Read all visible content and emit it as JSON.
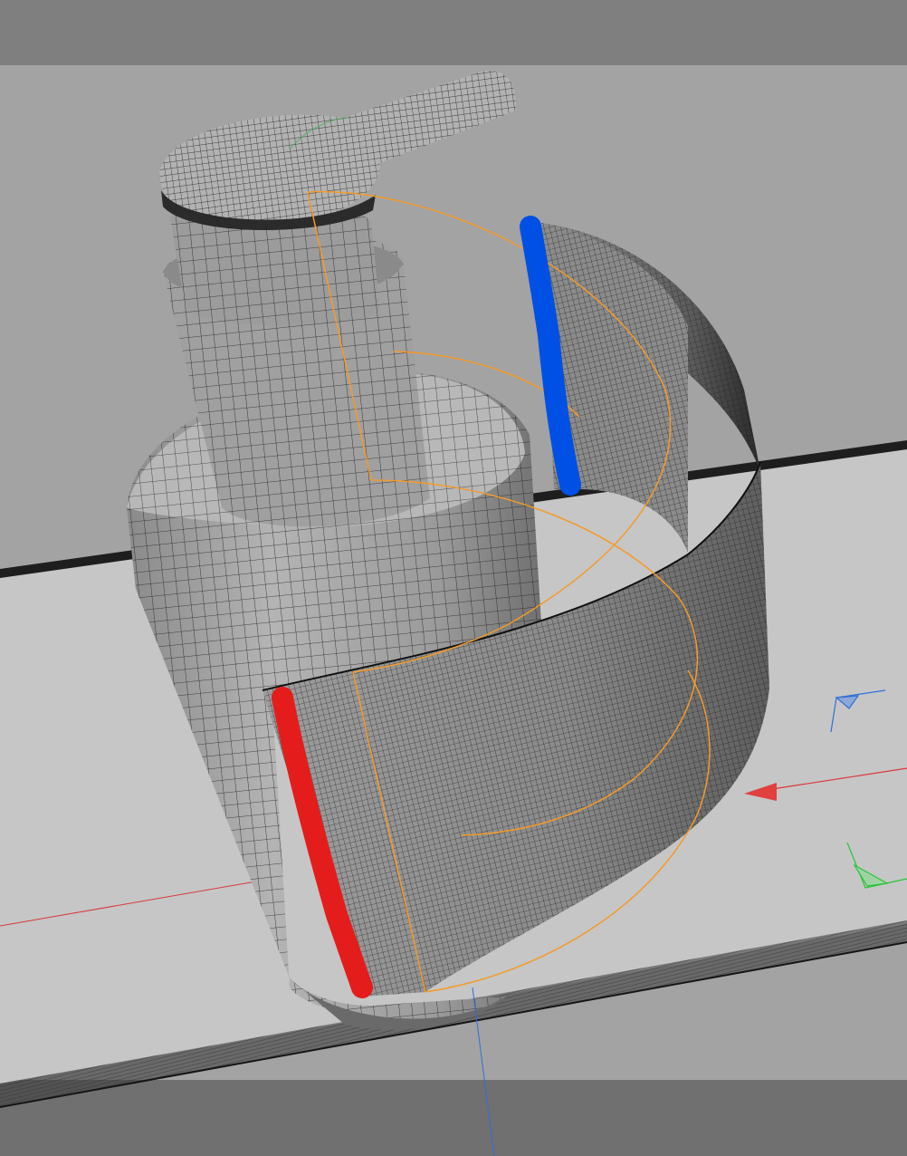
{
  "viewport": {
    "background_top": "#7f7f7f",
    "background_mid": "#a3a3a3",
    "background_floor": "#c9c9c9",
    "background_bottom": "#6f6f6f"
  },
  "scene": {
    "objects": [
      {
        "name": "bottle",
        "type": "wireframe-mesh"
      },
      {
        "name": "pump-head",
        "type": "wireframe-mesh"
      },
      {
        "name": "label-band",
        "type": "wireframe-mesh"
      },
      {
        "name": "ground-plane",
        "type": "wireframe-mesh"
      }
    ],
    "selection_outline_color": "#f39a2b",
    "markers": {
      "red_edge_color": "#e51c1c",
      "blue_edge_color": "#0050e6"
    },
    "axes": {
      "x_color": "#d9383a",
      "y_color": "#29c43a",
      "z_color": "#2f6fd6"
    }
  }
}
